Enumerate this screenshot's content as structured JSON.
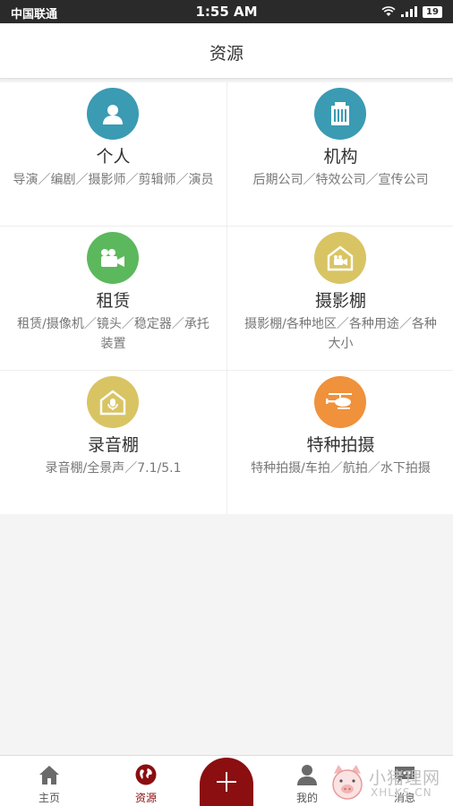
{
  "status_bar": {
    "carrier": "中国联通",
    "time": "1:55 AM",
    "battery": "19"
  },
  "header": {
    "title": "资源"
  },
  "colors": {
    "accent": "#8b0e10",
    "teal": "#3a9bb3",
    "green": "#5cb85c",
    "gold": "#d9c464",
    "orange": "#f0913c"
  },
  "categories": [
    {
      "title": "个人",
      "desc": "导演／编剧／摄影师／剪辑师／演员",
      "icon": "person-icon",
      "color": "#3a9bb3"
    },
    {
      "title": "机构",
      "desc": "后期公司／特效公司／宣传公司",
      "icon": "building-icon",
      "color": "#3a9bb3"
    },
    {
      "title": "租赁",
      "desc": "租赁/摄像机／镜头／稳定器／承托装置",
      "icon": "camera-icon",
      "color": "#5cb85c"
    },
    {
      "title": "摄影棚",
      "desc": "摄影棚/各种地区／各种用途／各种大小",
      "icon": "studio-camera-icon",
      "color": "#d9c464"
    },
    {
      "title": "录音棚",
      "desc": "录音棚/全景声／7.1/5.1",
      "icon": "studio-mic-icon",
      "color": "#d9c464"
    },
    {
      "title": "特种拍摄",
      "desc": "特种拍摄/车拍／航拍／水下拍摄",
      "icon": "helicopter-icon",
      "color": "#f0913c"
    }
  ],
  "tab_bar": {
    "home": "主页",
    "resources": "资源",
    "add": "+",
    "mine": "我的",
    "messages": "消息"
  },
  "watermark": {
    "text": "小猪理网",
    "url": "XHLKS.CN"
  }
}
